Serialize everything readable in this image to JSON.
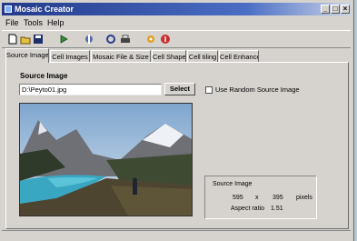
{
  "window": {
    "title": "Mosaic Creator",
    "controls": [
      "_",
      "□",
      "×"
    ]
  },
  "menu": [
    "File",
    "Tools",
    "Help"
  ],
  "toolbar": {
    "icons": [
      "new-icon",
      "open-icon",
      "save-icon",
      "play-icon",
      "tool-icon",
      "refresh-icon",
      "print-icon",
      "settings-icon",
      "info-icon"
    ]
  },
  "tabs": [
    {
      "label": "Source Image",
      "active": true
    },
    {
      "label": "Cell Images",
      "active": false
    },
    {
      "label": "Mosaic File & Size",
      "active": false
    },
    {
      "label": "Cell Shape",
      "active": false
    },
    {
      "label": "Cell tiling",
      "active": false
    },
    {
      "label": "Cell Enhance",
      "active": false
    }
  ],
  "source": {
    "label": "Source Image",
    "path": "D:\\Peyto01.jpg",
    "select_label": "Select",
    "random_label": "Use Random Source Image",
    "random_checked": false
  },
  "info": {
    "header": "Source Image",
    "width": "595",
    "times": "x",
    "height": "395",
    "unit": "pixels",
    "aspect_label": "Aspect ratio",
    "aspect_value": "1.51"
  },
  "colors": {
    "title_start": "#233a8a",
    "panel_bg": "#d6d3ce",
    "lake": "#3aa7c2"
  }
}
